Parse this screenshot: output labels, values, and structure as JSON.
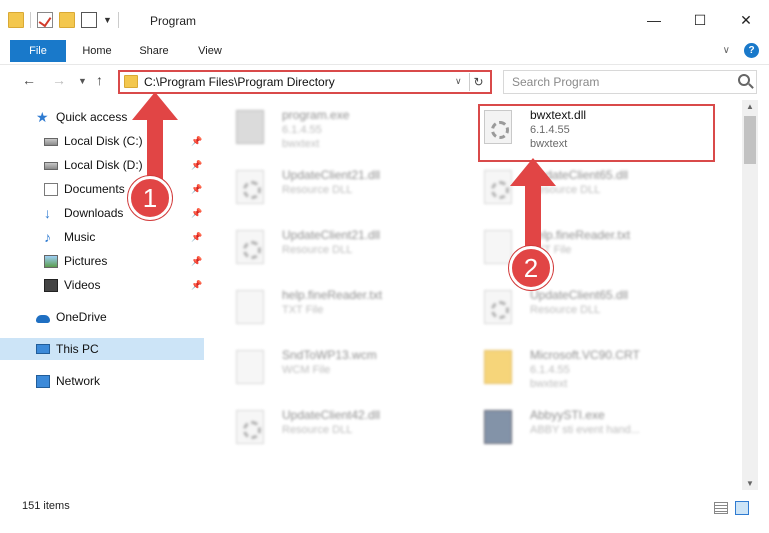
{
  "window": {
    "title": "Program",
    "controls": [
      "minimize",
      "maximize",
      "close"
    ]
  },
  "ribbon": {
    "tabs": [
      "File",
      "Home",
      "Share",
      "View"
    ]
  },
  "address": {
    "path": "C:\\Program Files\\Program Directory"
  },
  "search": {
    "placeholder": "Search Program"
  },
  "sidebar": {
    "items": [
      {
        "label": "Quick access",
        "icon": "star-icon"
      },
      {
        "label": "Local Disk (C:)",
        "icon": "drive-icon"
      },
      {
        "label": "Local Disk (D:)",
        "icon": "drive-icon"
      },
      {
        "label": "Documents",
        "icon": "documents-icon"
      },
      {
        "label": "Downloads",
        "icon": "download-icon"
      },
      {
        "label": "Music",
        "icon": "music-icon"
      },
      {
        "label": "Pictures",
        "icon": "pictures-icon"
      },
      {
        "label": "Videos",
        "icon": "videos-icon"
      },
      {
        "label": "OneDrive",
        "icon": "cloud-icon"
      },
      {
        "label": "This PC",
        "icon": "computer-icon"
      },
      {
        "label": "Network",
        "icon": "network-icon"
      }
    ]
  },
  "files": [
    {
      "name": "program.exe",
      "line1": "6.1.4.55",
      "line2": "bwxtext"
    },
    {
      "name": "bwxtext.dll",
      "line1": "6.1.4.55",
      "line2": "bwxtext"
    },
    {
      "name": "UpdateClient21.dll",
      "line1": "Resource DLL",
      "line2": ""
    },
    {
      "name": "UpdateClient65.dll",
      "line1": "Resource DLL",
      "line2": ""
    },
    {
      "name": "UpdateClient21.dll",
      "line1": "Resource DLL",
      "line2": ""
    },
    {
      "name": "help.fineReader.txt",
      "line1": "TXT File",
      "line2": ""
    },
    {
      "name": "help.fineReader.txt",
      "line1": "TXT File",
      "line2": ""
    },
    {
      "name": "UpdateClient65.dll",
      "line1": "Resource DLL",
      "line2": ""
    },
    {
      "name": "SndToWP13.wcm",
      "line1": "WCM File",
      "line2": ""
    },
    {
      "name": "Microsoft.VC90.CRT",
      "line1": "6.1.4.55",
      "line2": "bwxtext"
    },
    {
      "name": "UpdateClient42.dll",
      "line1": "Resource DLL",
      "line2": ""
    },
    {
      "name": "AbbyySTI.exe",
      "line1": "ABBY sti event hand...",
      "line2": ""
    }
  ],
  "status": {
    "item_count": "151 items"
  },
  "annotations": {
    "badge1": "1",
    "badge2": "2",
    "accent": "#e14545"
  }
}
